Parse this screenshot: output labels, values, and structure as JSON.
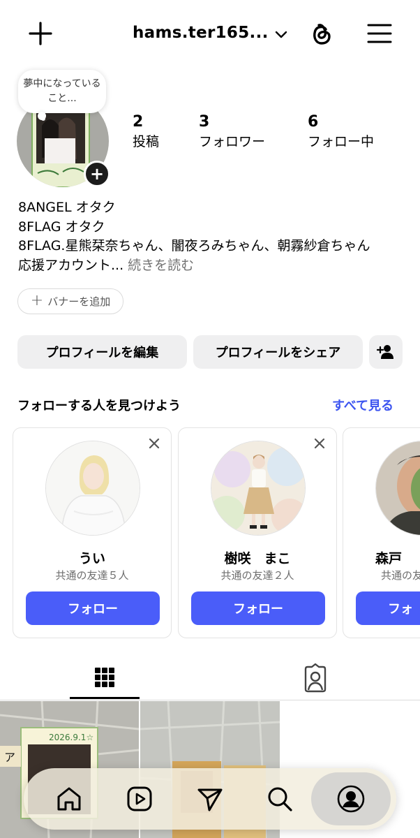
{
  "header": {
    "username": "hams.ter165...",
    "icons": [
      "plus-icon",
      "chevron-down-icon",
      "threads-icon",
      "menu-icon"
    ]
  },
  "note": {
    "text": "夢中になっていること..."
  },
  "stats": [
    {
      "count": "2",
      "label": "投稿"
    },
    {
      "count": "3",
      "label": "フォロワー"
    },
    {
      "count": "6",
      "label": "フォロー中"
    }
  ],
  "bio": {
    "lines": [
      "8ANGEL オタク",
      "8FLAG オタク",
      "8FLAG.星熊栞奈ちゃん、闇夜ろみちゃん、朝霧紗倉ちゃん",
      "応援アカウント..."
    ],
    "more": "続きを読む"
  },
  "banner": {
    "label": "バナーを追加"
  },
  "buttons": {
    "edit_profile": "プロフィールを編集",
    "share_profile": "プロフィールをシェア"
  },
  "suggestions": {
    "title": "フォローする人を見つけよう",
    "see_all": "すべて見る",
    "cards": [
      {
        "name": "うい",
        "mutual": "共通の友達５人",
        "follow": "フォロー"
      },
      {
        "name": "樹咲　まこ",
        "mutual": "共通の友達２人",
        "follow": "フォロー"
      },
      {
        "name": "森戸",
        "mutual": "共通の友",
        "follow": "フォ"
      }
    ]
  },
  "posts": {
    "post1_caption": "2026.9.1☆",
    "post1_side_text": "ア"
  },
  "nav": {
    "items": [
      "home-icon",
      "reels-icon",
      "send-icon",
      "search-icon",
      "profile-icon"
    ],
    "selected": "profile-icon"
  },
  "colors": {
    "accent_blue": "#4a5df9",
    "link_blue": "#3d55f0",
    "button_gray": "#efeff0",
    "muted_text": "#737373"
  }
}
